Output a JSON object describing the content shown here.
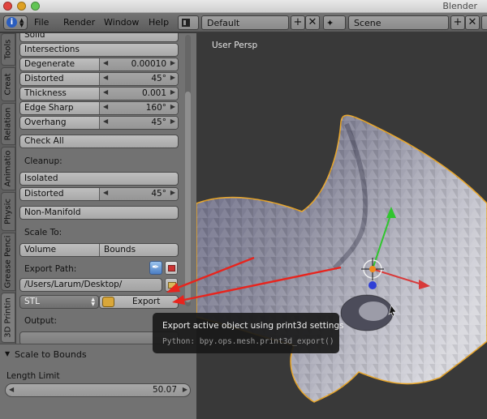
{
  "app_title": "Blender",
  "header": {
    "menus": [
      "File",
      "Render",
      "Window",
      "Help"
    ],
    "layout_value": "Default",
    "scene_value": "Scene"
  },
  "tabs": [
    "Tools",
    "Creat",
    "Relation",
    "Animatio",
    "Physic",
    "Grease Penci",
    "3D Printin"
  ],
  "panel": {
    "solid": "Solid",
    "intersections": "Intersections",
    "degenerate": {
      "label": "Degenerate",
      "value": "0.00010"
    },
    "distorted": {
      "label": "Distorted",
      "value": "45°"
    },
    "thickness": {
      "label": "Thickness",
      "value": "0.001"
    },
    "edge_sharp": {
      "label": "Edge Sharp",
      "value": "160°"
    },
    "overhang": {
      "label": "Overhang",
      "value": "45°"
    },
    "check_all": "Check All",
    "cleanup": "Cleanup:",
    "isolated": "Isolated",
    "cleanup_distorted": {
      "label": "Distorted",
      "value": "45°"
    },
    "non_manifold": "Non-Manifold",
    "scale_to": "Scale To:",
    "volume": "Volume",
    "bounds": "Bounds",
    "export_path_label": "Export Path:",
    "export_path_value": "/Users/Larum/Desktop/",
    "format": "STL",
    "export_button": "Export",
    "output": "Output:"
  },
  "operator": {
    "title": "Scale to Bounds",
    "length_limit_label": "Length Limit",
    "length_limit_value": "50.07"
  },
  "viewport": {
    "label": "User Persp"
  },
  "tooltip": {
    "description": "Export active object using print3d settings",
    "python": "Python: bpy.ops.mesh.print3d_export()"
  },
  "colors": {
    "arrow_red": "#e8241d",
    "axis_green": "#31c52f",
    "axis_red": "#d83a3a",
    "axis_blue": "#2f3fd6",
    "selection_orange": "#f0a020"
  }
}
